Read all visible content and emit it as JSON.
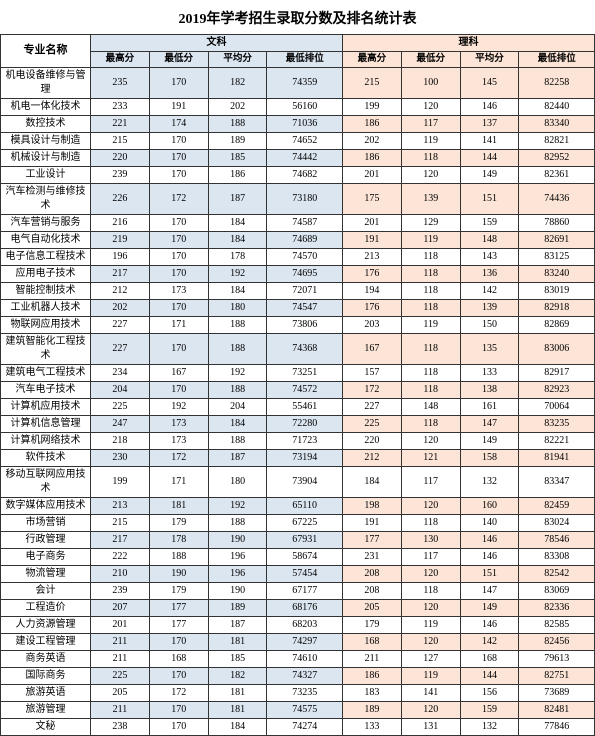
{
  "title": "2019年学考招生录取分数及排名统计表",
  "headers": {
    "major": "专业名称",
    "wenke": "文科",
    "like": "理科",
    "subHeaders": [
      "最高分",
      "最低分",
      "平均分",
      "最低排位",
      "最高分",
      "最低分",
      "平均分",
      "最低排位"
    ]
  },
  "rows": [
    [
      "机电设备维修与管理",
      "235",
      "170",
      "182",
      "74359",
      "215",
      "100",
      "145",
      "82258"
    ],
    [
      "机电一体化技术",
      "233",
      "191",
      "202",
      "56160",
      "199",
      "120",
      "146",
      "82440"
    ],
    [
      "数控技术",
      "221",
      "174",
      "188",
      "71036",
      "186",
      "117",
      "137",
      "83340"
    ],
    [
      "模具设计与制造",
      "215",
      "170",
      "189",
      "74652",
      "202",
      "119",
      "141",
      "82821"
    ],
    [
      "机械设计与制造",
      "220",
      "170",
      "185",
      "74442",
      "186",
      "118",
      "144",
      "82952"
    ],
    [
      "工业设计",
      "239",
      "170",
      "186",
      "74682",
      "201",
      "120",
      "149",
      "82361"
    ],
    [
      "汽车检测与维修技术",
      "226",
      "172",
      "187",
      "73180",
      "175",
      "139",
      "151",
      "74436"
    ],
    [
      "汽车营销与服务",
      "216",
      "170",
      "184",
      "74587",
      "201",
      "129",
      "159",
      "78860"
    ],
    [
      "电气自动化技术",
      "219",
      "170",
      "184",
      "74689",
      "191",
      "119",
      "148",
      "82691"
    ],
    [
      "电子信息工程技术",
      "196",
      "170",
      "178",
      "74570",
      "213",
      "118",
      "143",
      "83125"
    ],
    [
      "应用电子技术",
      "217",
      "170",
      "192",
      "74695",
      "176",
      "118",
      "136",
      "83240"
    ],
    [
      "智能控制技术",
      "212",
      "173",
      "184",
      "72071",
      "194",
      "118",
      "142",
      "83019"
    ],
    [
      "工业机器人技术",
      "202",
      "170",
      "180",
      "74547",
      "176",
      "118",
      "139",
      "82918"
    ],
    [
      "物联网应用技术",
      "227",
      "171",
      "188",
      "73806",
      "203",
      "119",
      "150",
      "82869"
    ],
    [
      "建筑智能化工程技术",
      "227",
      "170",
      "188",
      "74368",
      "167",
      "118",
      "135",
      "83006"
    ],
    [
      "建筑电气工程技术",
      "234",
      "167",
      "192",
      "73251",
      "157",
      "118",
      "133",
      "82917"
    ],
    [
      "汽车电子技术",
      "204",
      "170",
      "188",
      "74572",
      "172",
      "118",
      "138",
      "82923"
    ],
    [
      "计算机应用技术",
      "225",
      "192",
      "204",
      "55461",
      "227",
      "148",
      "161",
      "70064"
    ],
    [
      "计算机信息管理",
      "247",
      "173",
      "184",
      "72280",
      "225",
      "118",
      "147",
      "83235"
    ],
    [
      "计算机网络技术",
      "218",
      "173",
      "188",
      "71723",
      "220",
      "120",
      "149",
      "82221"
    ],
    [
      "软件技术",
      "230",
      "172",
      "187",
      "73194",
      "212",
      "121",
      "158",
      "81941"
    ],
    [
      "移动互联网应用技术",
      "199",
      "171",
      "180",
      "73904",
      "184",
      "117",
      "132",
      "83347"
    ],
    [
      "数字媒体应用技术",
      "213",
      "181",
      "192",
      "65110",
      "198",
      "120",
      "160",
      "82459"
    ],
    [
      "市场营销",
      "215",
      "179",
      "188",
      "67225",
      "191",
      "118",
      "140",
      "83024"
    ],
    [
      "行政管理",
      "217",
      "178",
      "190",
      "67931",
      "177",
      "130",
      "146",
      "78546"
    ],
    [
      "电子商务",
      "222",
      "188",
      "196",
      "58674",
      "231",
      "117",
      "146",
      "83308"
    ],
    [
      "物流管理",
      "210",
      "190",
      "196",
      "57454",
      "208",
      "120",
      "151",
      "82542"
    ],
    [
      "会计",
      "239",
      "179",
      "190",
      "67177",
      "208",
      "118",
      "147",
      "83069"
    ],
    [
      "工程造价",
      "207",
      "177",
      "189",
      "68176",
      "205",
      "120",
      "149",
      "82336"
    ],
    [
      "人力资源管理",
      "201",
      "177",
      "187",
      "68203",
      "179",
      "119",
      "146",
      "82585"
    ],
    [
      "建设工程管理",
      "211",
      "170",
      "181",
      "74297",
      "168",
      "120",
      "142",
      "82456"
    ],
    [
      "商务英语",
      "211",
      "168",
      "185",
      "74610",
      "211",
      "127",
      "168",
      "79613"
    ],
    [
      "国际商务",
      "225",
      "170",
      "182",
      "74327",
      "186",
      "119",
      "144",
      "82751"
    ],
    [
      "旅游英语",
      "205",
      "172",
      "181",
      "73235",
      "183",
      "141",
      "156",
      "73689"
    ],
    [
      "旅游管理",
      "211",
      "170",
      "181",
      "74575",
      "189",
      "120",
      "159",
      "82481"
    ],
    [
      "文秘",
      "238",
      "170",
      "184",
      "74274",
      "133",
      "131",
      "132",
      "77846"
    ]
  ]
}
